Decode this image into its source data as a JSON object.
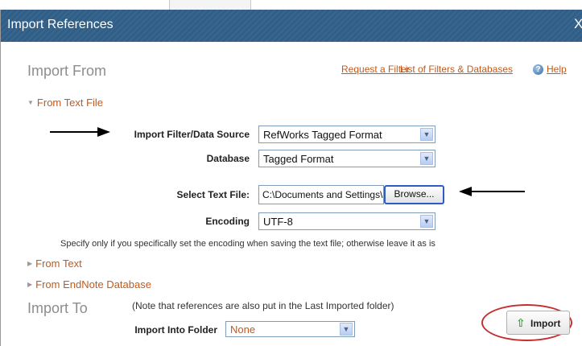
{
  "window": {
    "title": "Import References",
    "close_label": "X"
  },
  "import_from": {
    "heading": "Import From",
    "links": {
      "request_filter": "Request a Filter",
      "list_filters": "List of Filters & Databases",
      "help": "Help"
    },
    "from_text_file": {
      "label": "From Text File",
      "expanded": true,
      "filter_label": "Import Filter/Data Source",
      "filter_value": "RefWorks Tagged Format",
      "database_label": "Database",
      "database_value": "Tagged Format",
      "file_label": "Select Text File:",
      "file_value": "C:\\Documents and Settings\\",
      "browse_label": "Browse...",
      "encoding_label": "Encoding",
      "encoding_value": "UTF-8",
      "encoding_note": "Specify only if you specifically set the encoding when saving the text file; otherwise leave it as is"
    },
    "collapsed_sections": [
      {
        "label": "From Text"
      },
      {
        "label": "From EndNote Database"
      }
    ]
  },
  "import_to": {
    "heading": "Import To",
    "note": "(Note that references are also put in the Last Imported folder)",
    "folder_label": "Import Into Folder",
    "folder_value": "None",
    "import_button": "Import"
  },
  "colors": {
    "titlebar": "#2f5e87",
    "link": "#c25a1b",
    "annotation_circle": "#c43030"
  }
}
